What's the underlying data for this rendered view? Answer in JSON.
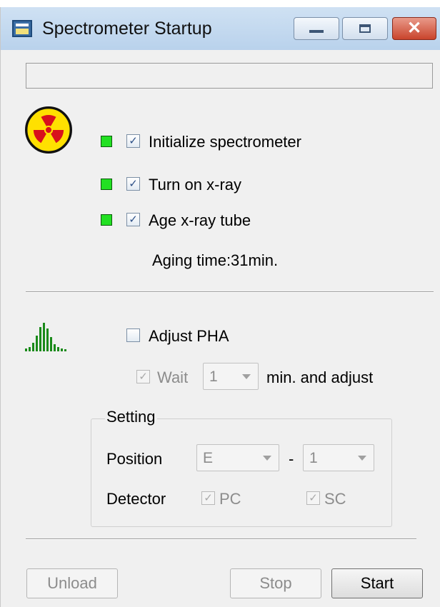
{
  "window": {
    "title": "Spectrometer Startup",
    "icon": "spectrometer-app-icon",
    "controls": {
      "minimize": "minimize-icon",
      "maximize": "maximize-icon",
      "close": "✕"
    }
  },
  "status": {
    "text": ""
  },
  "startup": {
    "icon": "radiation-hazard-icon",
    "steps": [
      {
        "label": "Initialize spectrometer",
        "checked": true,
        "indicator_color": "#22e022"
      },
      {
        "label": "Turn on x-ray",
        "checked": true,
        "indicator_color": "#22e022"
      },
      {
        "label": "Age x-ray tube",
        "checked": true,
        "indicator_color": "#22e022"
      }
    ],
    "aging_time": "Aging time:31min."
  },
  "pha": {
    "icon": "pha-spectrum-icon",
    "adjust_label": "Adjust PHA",
    "adjust_checked": false,
    "wait_label": "Wait",
    "wait_checked": true,
    "wait_value": "1",
    "wait_suffix": "min. and adjust",
    "setting": {
      "legend": "Setting",
      "position_label": "Position",
      "position_value": "E",
      "position_dash": "-",
      "position_index": "1",
      "detector_label": "Detector",
      "detector_pc": "PC",
      "detector_pc_checked": true,
      "detector_sc": "SC",
      "detector_sc_checked": true
    }
  },
  "buttons": {
    "unload": "Unload",
    "stop": "Stop",
    "start": "Start"
  },
  "check_glyph": "✓"
}
